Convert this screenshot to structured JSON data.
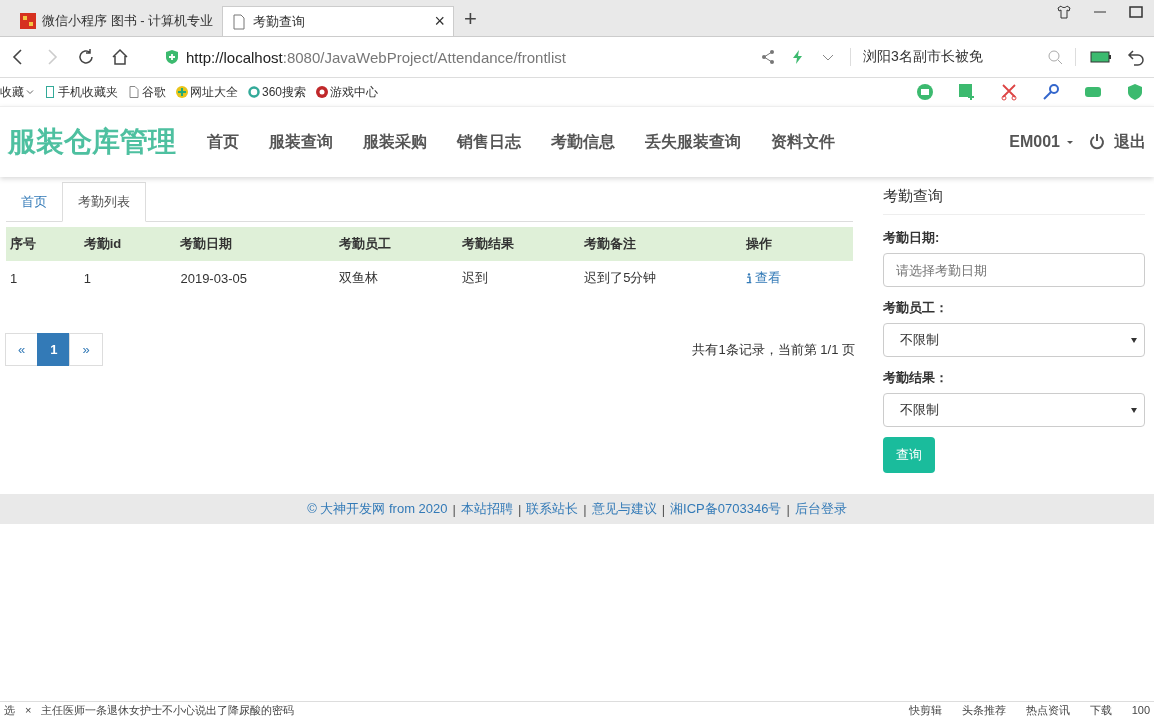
{
  "browser": {
    "tabs": [
      {
        "title": "微信小程序 图书 - 计算机专业",
        "selected": false,
        "kind": "app"
      },
      {
        "title": "考勤查询",
        "selected": true,
        "kind": "page"
      }
    ],
    "close_tab": "×",
    "new_tab": "+",
    "url": {
      "host": "http://localhost",
      "rest": ":8080/JavaWebProject/Attendance/frontlist"
    },
    "search_hint": "浏阳3名副市长被免",
    "bookmarks": [
      {
        "label": "收藏",
        "kind": "menu"
      },
      {
        "label": "手机收藏夹",
        "kind": "phone"
      },
      {
        "label": "谷歌",
        "kind": "page"
      },
      {
        "label": "网址大全",
        "kind": "plus"
      },
      {
        "label": "360搜索",
        "kind": "ring"
      },
      {
        "label": "游戏中心",
        "kind": "game"
      }
    ]
  },
  "navbar": {
    "brand": "服装仓库管理",
    "items": [
      "首页",
      "服装查询",
      "服装采购",
      "销售日志",
      "考勤信息",
      "丢失服装查询",
      "资料文件"
    ],
    "user": "EM001",
    "logout": "退出"
  },
  "tabs": [
    {
      "label": "首页",
      "selected": false
    },
    {
      "label": "考勤列表",
      "selected": true
    }
  ],
  "table": {
    "columns": [
      "序号",
      "考勤id",
      "考勤日期",
      "考勤员工",
      "考勤结果",
      "考勤备注",
      "操作"
    ],
    "rows": [
      {
        "cells": [
          "1",
          "1",
          "2019-03-05",
          "双鱼林",
          "迟到",
          "迟到了5分钟"
        ],
        "action": "查看"
      }
    ]
  },
  "pagination": {
    "pages": [
      {
        "label": "«",
        "selected": false
      },
      {
        "label": "1",
        "selected": true
      },
      {
        "label": "»",
        "selected": false
      }
    ],
    "summary": "共有1条记录，当前第 1/1 页"
  },
  "search_panel": {
    "title": "考勤查询",
    "fields": [
      {
        "label": "考勤日期:",
        "kind": "text",
        "placeholder": "请选择考勤日期"
      },
      {
        "label": "考勤员工：",
        "kind": "select",
        "value": "不限制"
      },
      {
        "label": "考勤结果：",
        "kind": "select",
        "value": "不限制"
      }
    ],
    "button": "查询"
  },
  "footer": {
    "links": [
      "© 大神开发网 from 2020",
      "本站招聘",
      "联系站长",
      "意见与建议",
      "湘ICP备0703346号",
      "后台登录"
    ],
    "separator": "|"
  },
  "status_bar": {
    "left": "选",
    "close": "×",
    "news": "主任医师一条退休女护士不小心说出了降尿酸的密码",
    "items": [
      "快剪辑",
      "头条推荐",
      "热点资讯",
      "下载"
    ],
    "zoom": "100"
  }
}
